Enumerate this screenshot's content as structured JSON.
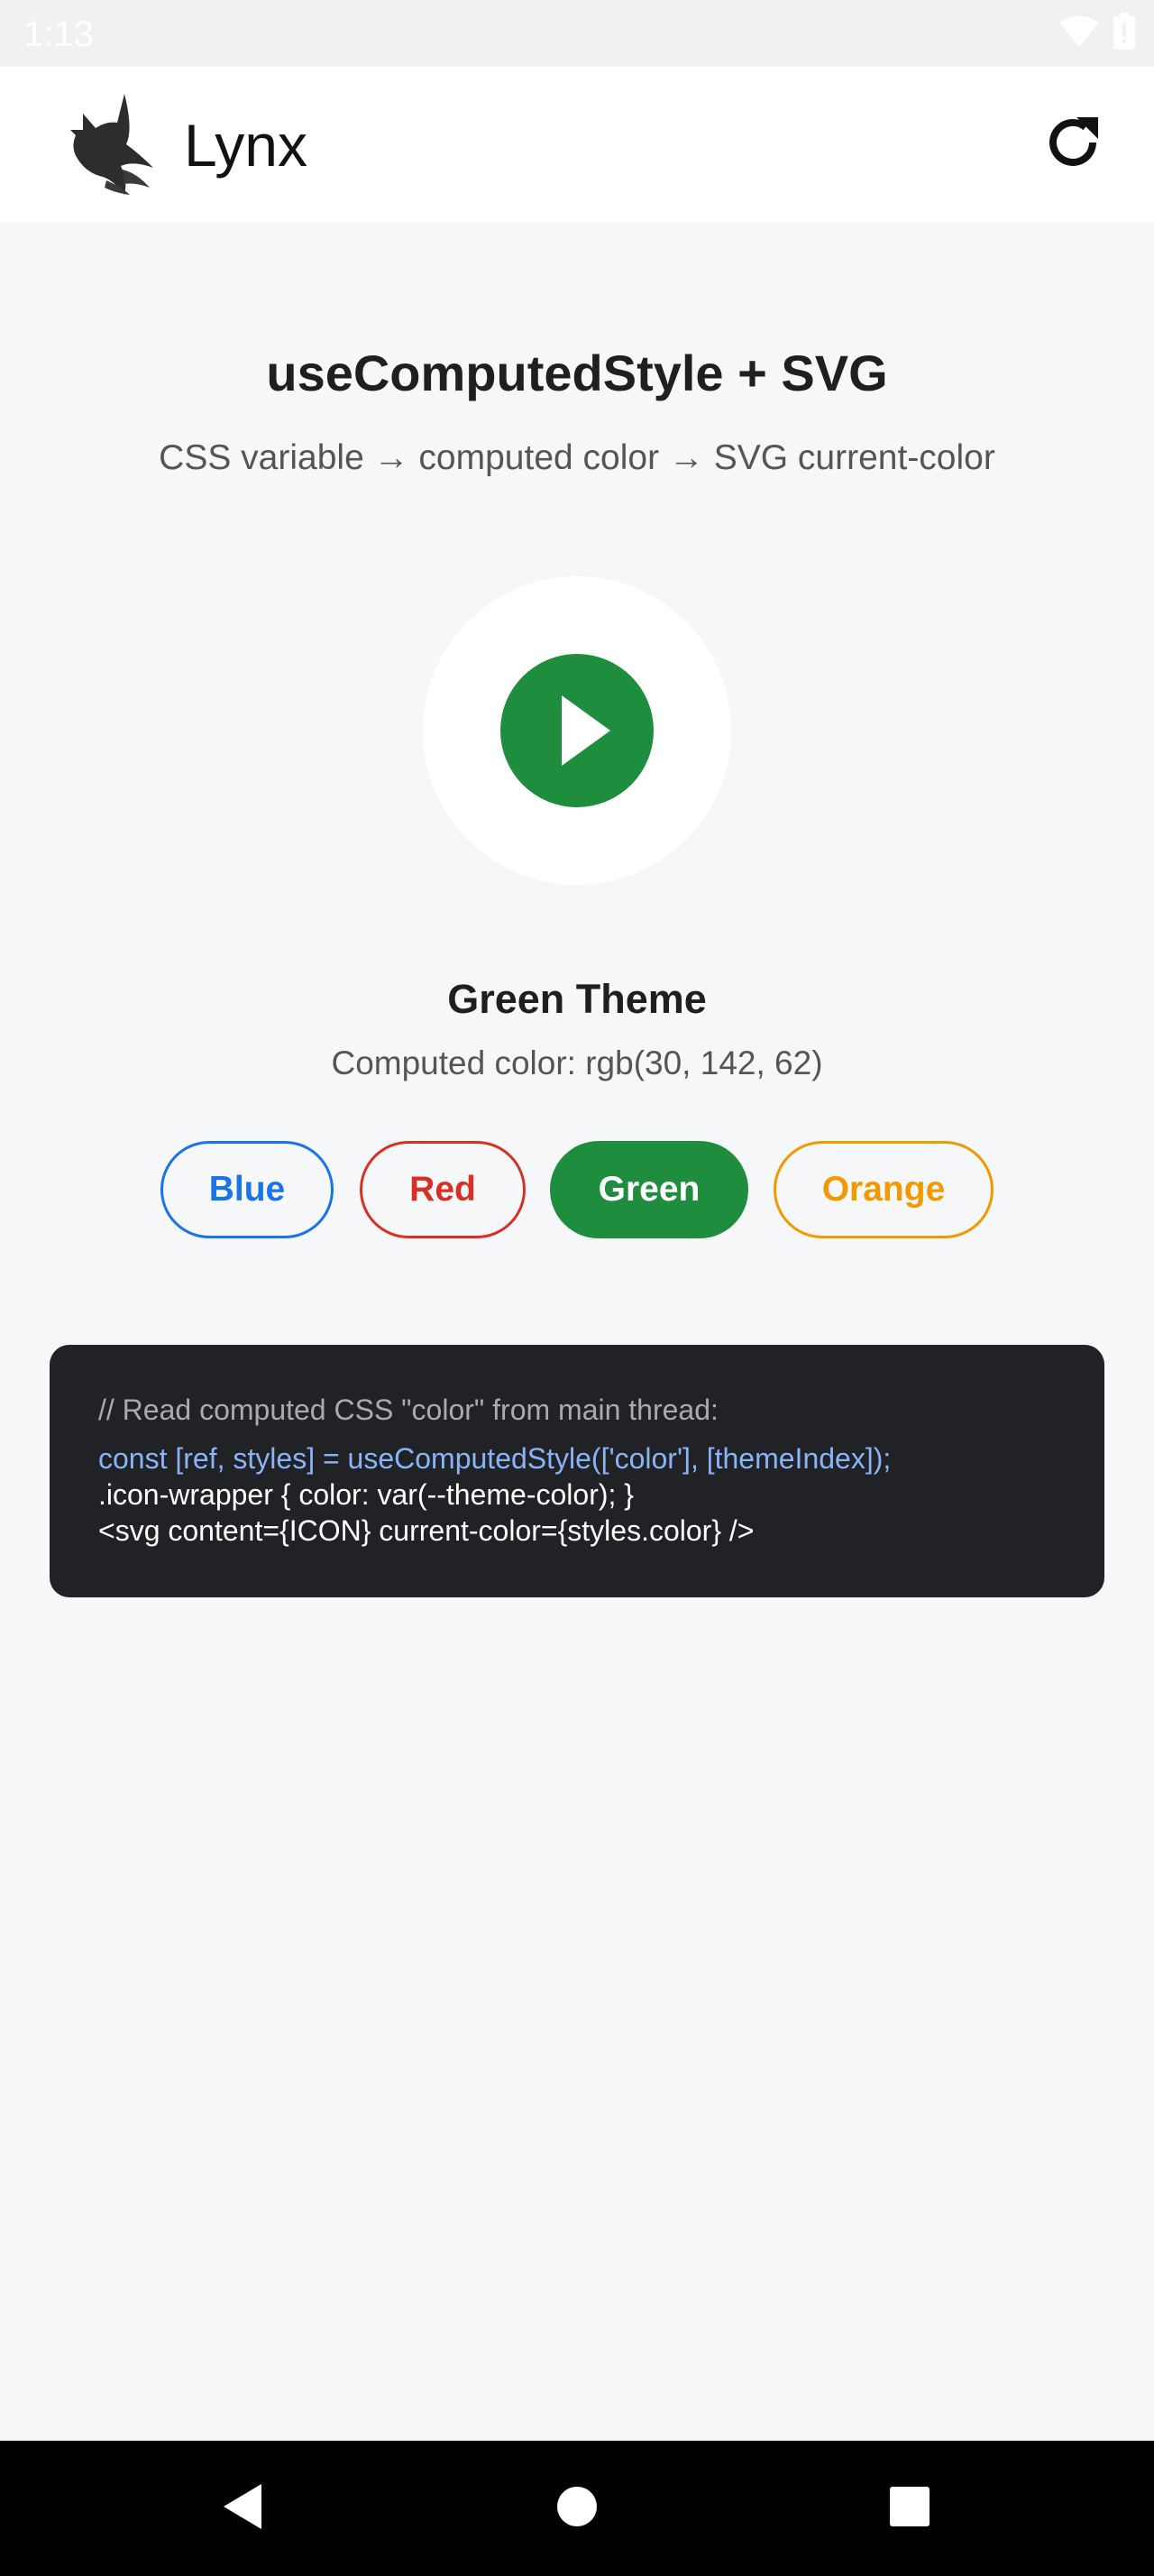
{
  "status_bar": {
    "time": "1:13",
    "icons": [
      "wifi-icon",
      "battery-icon"
    ]
  },
  "app_bar": {
    "title": "Lynx",
    "logo": "lynx-logo",
    "refresh_icon": "refresh-icon"
  },
  "header": {
    "title": "useComputedStyle + SVG",
    "subtitle": "CSS variable → computed color → SVG current-color"
  },
  "preview": {
    "icon": "play-icon",
    "color": "#1e8e3e"
  },
  "theme": {
    "name": "Green Theme",
    "computed_text": "Computed color: rgb(30, 142, 62)"
  },
  "theme_buttons": [
    {
      "label": "Blue",
      "color": "#1a73e8",
      "selected": false
    },
    {
      "label": "Red",
      "color": "#d93025",
      "selected": false
    },
    {
      "label": "Green",
      "color": "#1e8e3e",
      "selected": true
    },
    {
      "label": "Orange",
      "color": "#f29900",
      "selected": false
    }
  ],
  "code": {
    "comment": "// Read computed CSS \"color\" from main thread:",
    "line1": "const [ref, styles] = useComputedStyle(['color'], [themeIndex]);",
    "line2": ".icon-wrapper { color: var(--theme-color); }",
    "line3": "<svg content={ICON} current-color={styles.color} />"
  },
  "nav_bar": {
    "icons": [
      "back-icon",
      "home-icon",
      "recents-icon"
    ]
  }
}
